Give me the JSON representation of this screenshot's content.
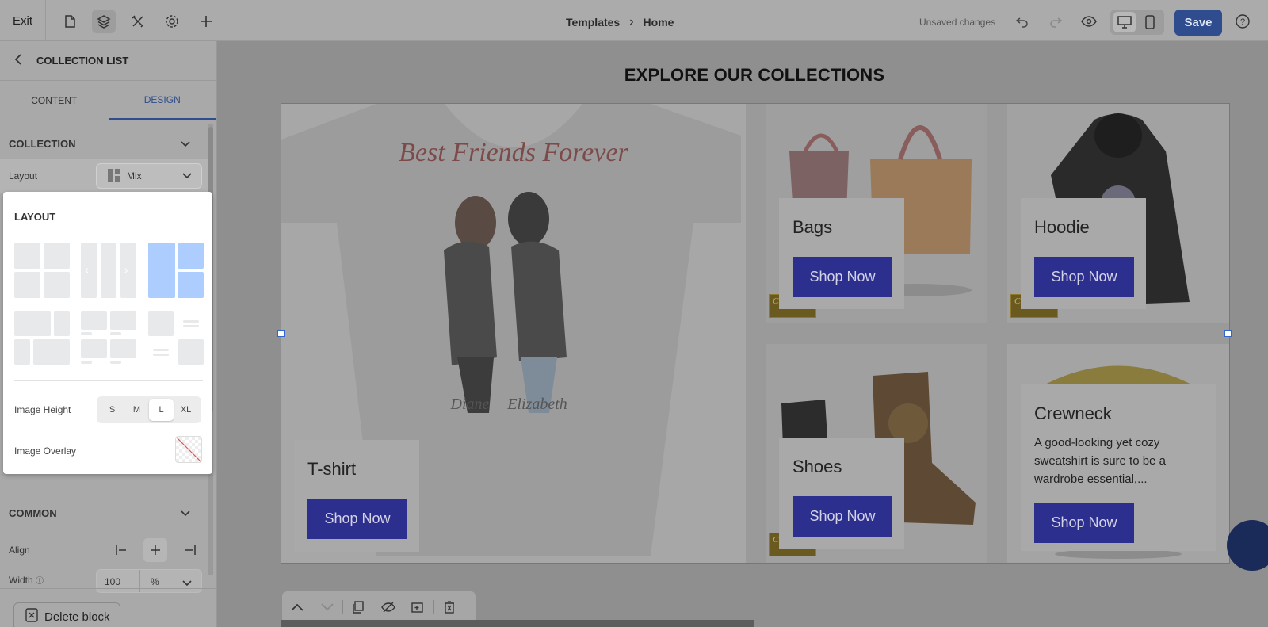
{
  "topbar": {
    "exit_label": "Exit",
    "breadcrumb": [
      "Templates",
      "Home"
    ],
    "status": "Unsaved changes",
    "save_label": "Save"
  },
  "panel": {
    "header_title": "COLLECTION LIST",
    "tabs": [
      "CONTENT",
      "DESIGN"
    ],
    "active_tab": "DESIGN",
    "collection_section": "COLLECTION",
    "layout_label": "Layout",
    "layout_value": "Mix",
    "popover": {
      "title": "LAYOUT",
      "image_height_label": "Image Height",
      "image_height_options": [
        "S",
        "M",
        "L",
        "XL"
      ],
      "image_height_selected": "L",
      "image_overlay_label": "Image Overlay"
    },
    "common_section": "COMMON",
    "align_label": "Align",
    "width_label": "Width",
    "width_value": "100",
    "width_unit": "%",
    "delete_label": "Delete block"
  },
  "canvas": {
    "section_title": "EXPLORE OUR COLLECTIONS",
    "collections": [
      {
        "title": "T-shirt",
        "button": "Shop Now",
        "image_text": "Best Friends Forever",
        "names": [
          "Diane",
          "Elizabeth"
        ]
      },
      {
        "title": "Bags",
        "button": "Shop Now"
      },
      {
        "title": "Hoodie",
        "button": "Shop Now"
      },
      {
        "title": "Shoes",
        "button": "Shop Now"
      },
      {
        "title": "Crewneck",
        "description": "A good-looking yet cozy sweatshirt is sure to be a wardrobe essential,...",
        "button": "Shop Now"
      }
    ],
    "badge_text": "Customized"
  },
  "colors": {
    "accent": "#2f4d8e",
    "button": "#2d2f8f",
    "selection": "#5577cc"
  }
}
